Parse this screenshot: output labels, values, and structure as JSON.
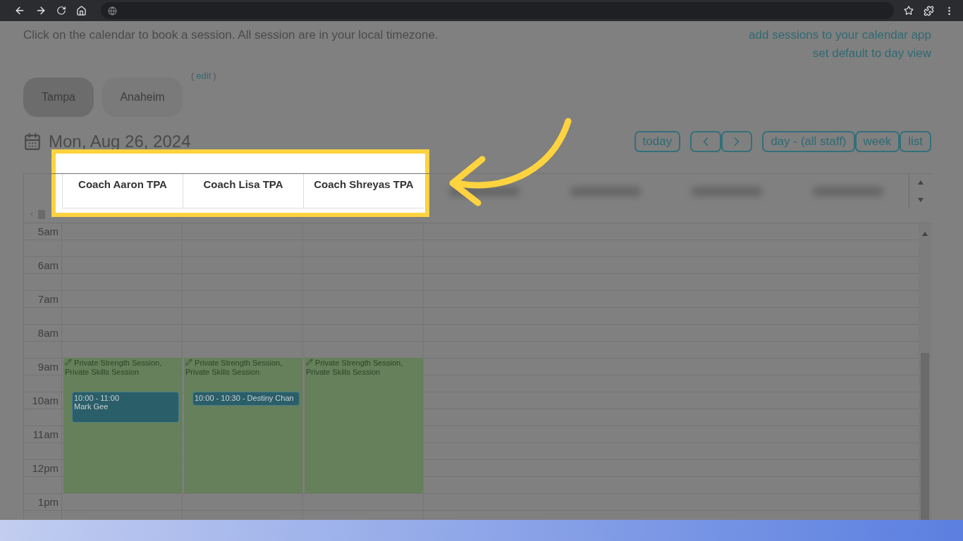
{
  "intro": "Click on the calendar to book a session. All session are in your local timezone.",
  "links": [
    "add sessions to your calendar app",
    "set default to day view"
  ],
  "locations": [
    {
      "label": "Tampa",
      "selected": true
    },
    {
      "label": "Anaheim",
      "selected": false
    }
  ],
  "edit": {
    "open": "(",
    "label": "edit",
    "close": ")"
  },
  "date": "Mon, Aug 26, 2024",
  "toolbar": {
    "today": "today",
    "views": [
      "day - (all staff)",
      "week",
      "list"
    ]
  },
  "columns": [
    {
      "name": "Coach Aaron TPA",
      "availability": "Private Strength Session, Private Skills Session",
      "events": [
        {
          "kind": "two_line",
          "time": "10:00 - 11:00",
          "title": "Mark Gee"
        }
      ]
    },
    {
      "name": "Coach Lisa TPA",
      "availability": "Private Strength Session, Private Skills Session",
      "events": [
        {
          "kind": "one_line",
          "text": "10:00 - 10:30 - Destiny Chan"
        }
      ]
    },
    {
      "name": "Coach Shreyas TPA",
      "availability": "Private Strength Session, Private Skills Session"
    }
  ],
  "hours": [
    "5am",
    "6am",
    "7am",
    "8am",
    "9am",
    "10am",
    "11am",
    "12pm",
    "1pm"
  ]
}
